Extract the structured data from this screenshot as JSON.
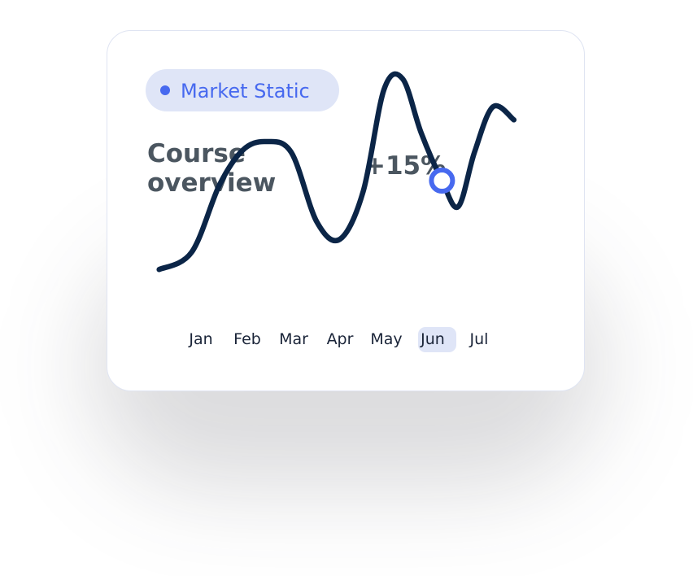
{
  "colors": {
    "line": "#0b2547",
    "accent": "#4769ef",
    "badge_bg": "#dfe5f7",
    "title_text": "#4b5660",
    "month_text": "#1a2438"
  },
  "badge": {
    "label": "Market Static",
    "dot_icon": "dot-icon"
  },
  "chart_data": {
    "type": "line",
    "title": "Course overview",
    "annotation": "+15%",
    "categories": [
      "Jan",
      "Feb",
      "Mar",
      "Apr",
      "May",
      "Jun",
      "Jul"
    ],
    "highlighted_category": "Jun",
    "grid": false,
    "legend": "none",
    "series": [
      {
        "x": [
          -0.9,
          -0.2,
          0.4,
          0.9,
          1.4,
          1.95,
          2.5,
          3.0,
          3.5,
          3.95,
          4.35,
          4.75,
          5.2,
          5.55,
          5.9,
          6.3,
          6.75
        ],
        "values": [
          0.0,
          0.8,
          3.9,
          5.5,
          5.9,
          5.4,
          2.2,
          1.4,
          3.6,
          8.3,
          8.8,
          6.3,
          4.1,
          2.9,
          5.4,
          7.5,
          6.9
        ]
      }
    ],
    "highlight_point": {
      "x": 5.2,
      "value": 4.1
    },
    "xlim": [
      -1.2,
      7.1
    ],
    "ylim": [
      -1.0,
      9.5
    ]
  }
}
